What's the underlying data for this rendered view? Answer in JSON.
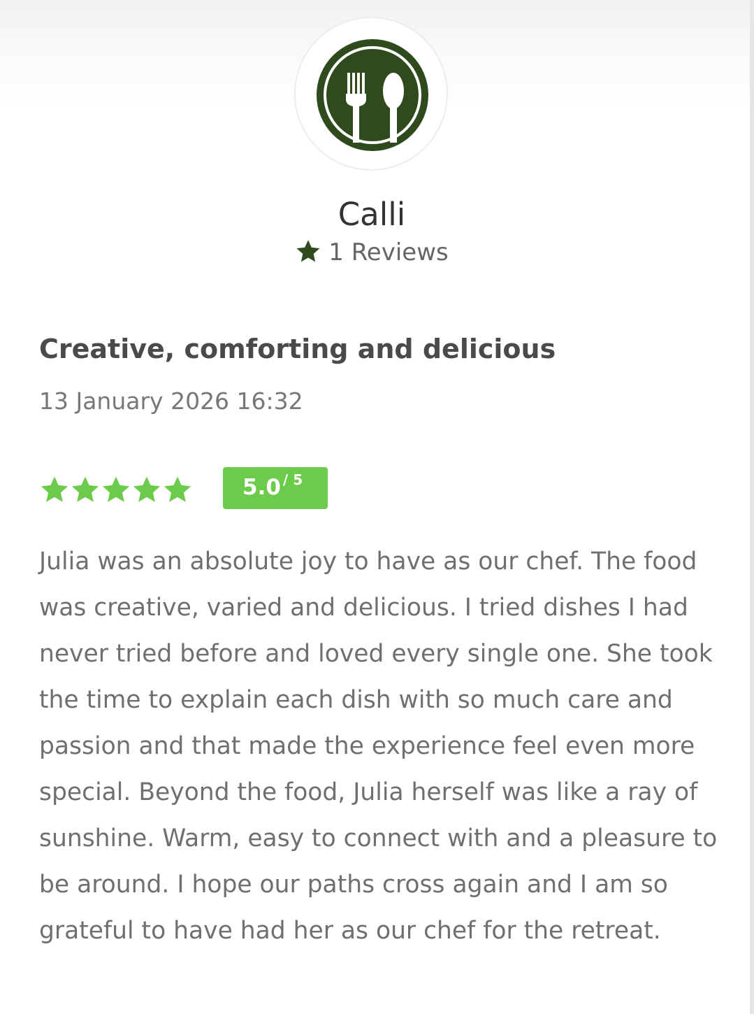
{
  "reviewer": {
    "avatar_icon": "fork-and-spoon-icon",
    "avatar_color": "#2f4a1c",
    "name": "Calli",
    "review_count_icon": "star-icon",
    "review_count_text": "1 Reviews"
  },
  "review": {
    "title": "Creative, comforting and delicious",
    "date": "13 January 2026 16:32",
    "rating": {
      "stars_filled": 5,
      "stars_total": 5,
      "star_color": "#6ccb4b",
      "score": "5.0",
      "score_max": "/ 5"
    },
    "body": "Julia was an absolute joy to have as our chef. The food was creative, varied and delicious. I tried dishes I had never tried before and loved every single one. She took the time to explain each dish with so much care and passion and that made the experience feel even more special. Beyond the food, Julia herself was like a ray of sunshine. Warm, easy to connect with and a pleasure to be around. I hope our paths cross again and I am so grateful to have had her as our chef for the retreat."
  }
}
